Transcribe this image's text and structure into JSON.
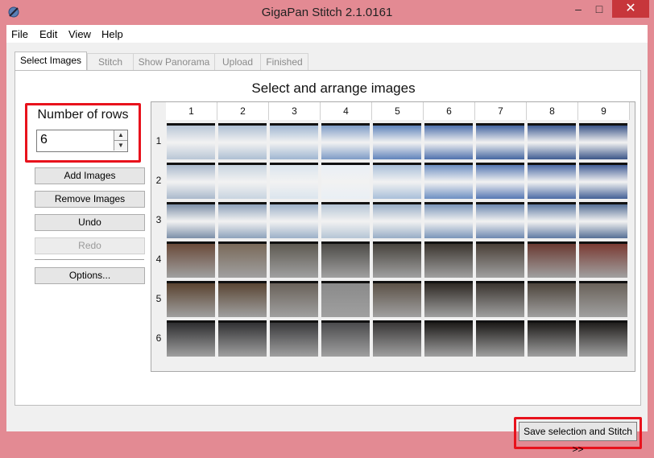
{
  "window": {
    "title": "GigaPan Stitch 2.1.0161",
    "minimize": "–",
    "maximize": "□",
    "close": "✕"
  },
  "menu": [
    "File",
    "Edit",
    "View",
    "Help"
  ],
  "tabs": [
    "Select Images",
    "Stitch",
    "Show Panorama",
    "Upload",
    "Finished"
  ],
  "heading": "Select and arrange images",
  "rows_group": {
    "label": "Number of rows",
    "value": "6"
  },
  "buttons": {
    "add": "Add Images",
    "remove": "Remove Images",
    "undo": "Undo",
    "redo": "Redo",
    "options": "Options..."
  },
  "grid": {
    "columns": [
      "1",
      "2",
      "3",
      "4",
      "5",
      "6",
      "7",
      "8",
      "9"
    ],
    "rows": [
      "1",
      "2",
      "3",
      "4",
      "5",
      "6"
    ],
    "thumb_colors": [
      [
        "#b9c6d6",
        "#aebfd3",
        "#9fb6d1",
        "#7e9cc6",
        "#5f83bb",
        "#4f71ad",
        "#4466a1",
        "#3f5c93",
        "#3b5588"
      ],
      [
        "#aab9cc",
        "#c8d4e0",
        "#dbe5ee",
        "#e9eff5",
        "#a9bfd9",
        "#6d8fc2",
        "#5577b3",
        "#4b6aa5",
        "#435f96"
      ],
      [
        "#7c8fa8",
        "#8ea2bb",
        "#9cb0c8",
        "#b5c5d5",
        "#98adc6",
        "#7a95b9",
        "#6d88b0",
        "#5f7aa3",
        "#566f95"
      ],
      [
        "#6a4b3a",
        "#7a6a5a",
        "#5e5a52",
        "#4e4c48",
        "#48443e",
        "#3c3630",
        "#4a4038",
        "#6a3a32",
        "#7a3b33"
      ],
      [
        "#5a4330",
        "#5a4634",
        "#6a625a",
        "#8a8a8a",
        "#5c5248",
        "#2f2a25",
        "#3b3530",
        "#4e453c",
        "#6a625a"
      ],
      [
        "#2e2e30",
        "#323234",
        "#3a3a3c",
        "#4c4c4e",
        "#3a3838",
        "#1e1c1a",
        "#1c1a18",
        "#1f1d1b",
        "#211f1d"
      ]
    ]
  },
  "stitch_button": "Save selection and Stitch >>"
}
